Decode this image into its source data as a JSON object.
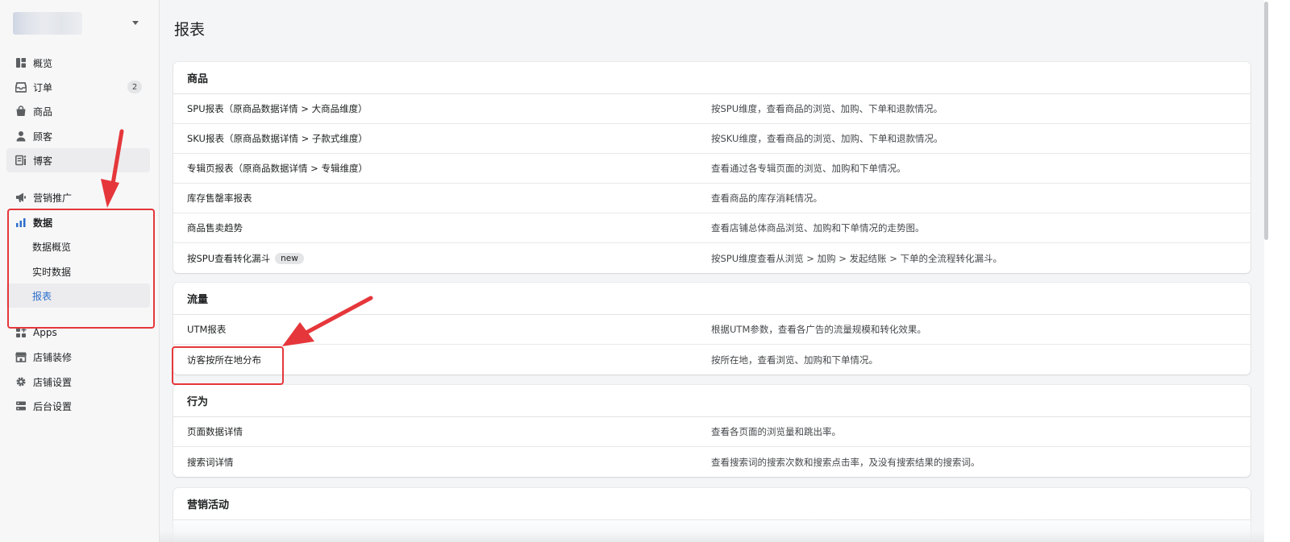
{
  "sidebar": {
    "items": [
      {
        "label": "概览",
        "icon": "overview-icon"
      },
      {
        "label": "订单",
        "icon": "inbox-icon",
        "badge": "2"
      },
      {
        "label": "商品",
        "icon": "bag-icon"
      },
      {
        "label": "顾客",
        "icon": "person-icon"
      },
      {
        "label": "博客",
        "icon": "blog-icon"
      },
      {
        "label": "营销推广",
        "icon": "megaphone-icon"
      },
      {
        "label": "数据",
        "icon": "bar-chart-icon"
      },
      {
        "label": "Apps",
        "icon": "apps-icon"
      },
      {
        "label": "店铺装修",
        "icon": "store-icon"
      },
      {
        "label": "店铺设置",
        "icon": "gear-icon"
      },
      {
        "label": "后台设置",
        "icon": "server-icon"
      }
    ],
    "data_sub": [
      {
        "label": "数据概览"
      },
      {
        "label": "实时数据"
      },
      {
        "label": "报表"
      }
    ]
  },
  "main": {
    "title": "报表",
    "sections": [
      {
        "title": "商品",
        "rows": [
          {
            "name": "SPU报表（原商品数据详情 > 大商品维度）",
            "desc": "按SPU维度，查看商品的浏览、加购、下单和退款情况。"
          },
          {
            "name": "SKU报表（原商品数据详情 > 子款式维度）",
            "desc": "按SKU维度，查看商品的浏览、加购、下单和退款情况。"
          },
          {
            "name": "专辑页报表（原商品数据详情 > 专辑维度）",
            "desc": "查看通过各专辑页面的浏览、加购和下单情况。"
          },
          {
            "name": "库存售罄率报表",
            "desc": "查看商品的库存消耗情况。"
          },
          {
            "name": "商品售卖趋势",
            "desc": "查看店铺总体商品浏览、加购和下单情况的走势图。"
          },
          {
            "name": "按SPU查看转化漏斗",
            "tag": "new",
            "desc": "按SPU维度查看从浏览 > 加购 > 发起结账 > 下单的全流程转化漏斗。"
          }
        ]
      },
      {
        "title": "流量",
        "rows": [
          {
            "name": "UTM报表",
            "desc": "根据UTM参数，查看各广告的流量规模和转化效果。"
          },
          {
            "name": "访客按所在地分布",
            "desc": "按所在地，查看浏览、加购和下单情况。"
          }
        ]
      },
      {
        "title": "行为",
        "rows": [
          {
            "name": "页面数据详情",
            "desc": "查看各页面的浏览量和跳出率。"
          },
          {
            "name": "搜索词详情",
            "desc": "查看搜索词的搜索次数和搜索点击率，及没有搜索结果的搜索词。"
          }
        ]
      },
      {
        "title": "营销活动",
        "rows": []
      }
    ]
  },
  "colors": {
    "accent": "#2c6ecb",
    "annotation": "#e5373b"
  }
}
